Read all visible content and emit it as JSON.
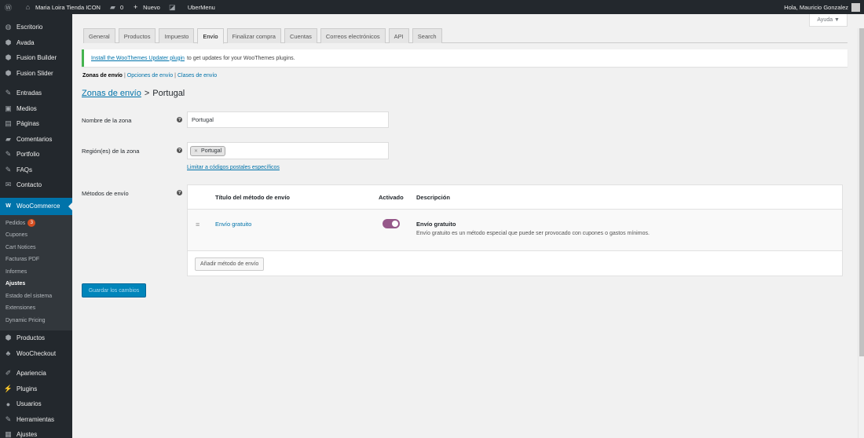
{
  "adminbar": {
    "site_name": "Maria Loira Tienda ICON",
    "comments_count": "0",
    "new_label": "Nuevo",
    "ubermenu_label": "UberMenu",
    "greeting": "Hola, Mauricio Gonzalez"
  },
  "sidebar": {
    "items_top": [
      {
        "label": "Escritorio",
        "icon": "dashboard-icon",
        "glyph": "◍"
      },
      {
        "label": "Avada",
        "icon": "avada-icon",
        "glyph": "⬢"
      },
      {
        "label": "Fusion Builder",
        "icon": "fusion-builder-icon",
        "glyph": "⬢"
      },
      {
        "label": "Fusion Slider",
        "icon": "fusion-slider-icon",
        "glyph": "⬢"
      }
    ],
    "items_content": [
      {
        "label": "Entradas",
        "icon": "pin-icon",
        "glyph": "✎"
      },
      {
        "label": "Medios",
        "icon": "media-icon",
        "glyph": "▣"
      },
      {
        "label": "Páginas",
        "icon": "pages-icon",
        "glyph": "▤"
      },
      {
        "label": "Comentarios",
        "icon": "comments-icon",
        "glyph": "▰"
      },
      {
        "label": "Portfolio",
        "icon": "portfolio-pin-icon",
        "glyph": "✎"
      },
      {
        "label": "FAQs",
        "icon": "faqs-pin-icon",
        "glyph": "✎"
      },
      {
        "label": "Contacto",
        "icon": "mail-icon",
        "glyph": "✉"
      }
    ],
    "woocommerce": {
      "label": "WooCommerce",
      "glyph": "W"
    },
    "submenu": [
      {
        "label": "Pedidos",
        "badge": "3"
      },
      {
        "label": "Cupones"
      },
      {
        "label": "Cart Notices"
      },
      {
        "label": "Facturas PDF"
      },
      {
        "label": "Informes"
      },
      {
        "label": "Ajustes",
        "current": true
      },
      {
        "label": "Estado del sistema"
      },
      {
        "label": "Extensiones"
      },
      {
        "label": "Dynamic Pricing"
      }
    ],
    "items_bottom": [
      {
        "label": "Productos",
        "icon": "products-icon",
        "glyph": "⬢"
      },
      {
        "label": "WooCheckout",
        "icon": "woocheckout-icon",
        "glyph": "♣"
      }
    ],
    "items_admin": [
      {
        "label": "Apariencia",
        "icon": "appearance-icon",
        "glyph": "✐"
      },
      {
        "label": "Plugins",
        "icon": "plugins-icon",
        "glyph": "⚡"
      },
      {
        "label": "Usuarios",
        "icon": "users-icon",
        "glyph": "●"
      },
      {
        "label": "Herramientas",
        "icon": "tools-icon",
        "glyph": "✎"
      },
      {
        "label": "Ajustes",
        "icon": "settings-icon",
        "glyph": "▦"
      }
    ]
  },
  "help_tab": "Ayuda ▼",
  "tabs": [
    "General",
    "Productos",
    "Impuesto",
    "Envío",
    "Finalizar compra",
    "Cuentas",
    "Correos electrónicos",
    "API",
    "Search"
  ],
  "active_tab": 3,
  "notice": {
    "link": "Install the WooThemes Updater plugin",
    "text": "to get updates for your WooThemes plugins."
  },
  "subsub": {
    "current": "Zonas de envío",
    "sep": "|",
    "options": "Opciones de envío",
    "classes": "Clases de envío"
  },
  "heading": {
    "link": "Zonas de envío",
    "sep": ">",
    "current": "Portugal"
  },
  "form": {
    "zone_name_label": "Nombre de la zona",
    "zone_name_value": "Portugal",
    "region_label": "Región(es) de la zona",
    "region_chip": "Portugal",
    "postcode_link": "Limitar a códigos postales específicos",
    "methods_label": "Métodos de envío",
    "help_glyph": "?"
  },
  "methods_table": {
    "headers": {
      "title": "Título del método de envío",
      "enabled": "Activado",
      "description": "Descripción"
    },
    "rows": [
      {
        "title": "Envío gratuito",
        "enabled": true,
        "desc_title": "Envío gratuito",
        "desc_text": "Envío gratuito es un método especial que puede ser provocado con cupones o gastos mínimos."
      }
    ],
    "add_button": "Añadir método de envío"
  },
  "save_button": "Guardar los cambios",
  "colors": {
    "accent": "#0073aa",
    "admin_bg": "#23282d",
    "toggle_on": "#96588a",
    "notice_border": "#46b450"
  }
}
